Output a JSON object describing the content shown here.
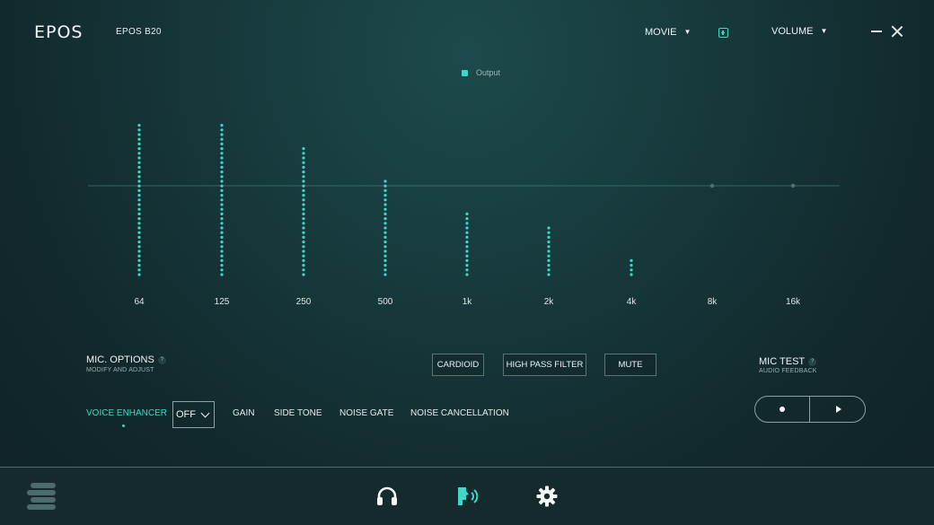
{
  "header": {
    "brand": "EPOS",
    "device_name": "EPOS B20",
    "preset_label": "MOVIE",
    "volume_label": "VOLUME",
    "add_preset_icon": "plus-square-icon",
    "minimize_icon": "minimize-icon",
    "close_icon": "close-icon"
  },
  "chart_data": {
    "type": "bar",
    "legend": [
      "Output"
    ],
    "series": [
      {
        "name": "Output",
        "values": [
          5.5,
          5.5,
          3.5,
          0.5,
          -2.5,
          -3.5,
          -6.5,
          0,
          0
        ]
      }
    ],
    "categories": [
      "64",
      "125",
      "250",
      "500",
      "1k",
      "2k",
      "4k",
      "8k",
      "16k"
    ],
    "ylim": [
      -8,
      5.5
    ],
    "grid": false,
    "colors": {
      "accent": "#3fd8c6",
      "neutral": "#55706f"
    }
  },
  "mic_options": {
    "title": "MIC. OPTIONS",
    "subtitle": "MODIFY AND ADJUST",
    "help": "?",
    "cardioid_label": "CARDIOID",
    "high_pass_label": "HIGH PASS FILTER",
    "mute_label": "MUTE"
  },
  "tabs": {
    "voice_enhancer": "VOICE ENHANCER",
    "gain": "GAIN",
    "side_tone": "SIDE TONE",
    "noise_gate": "NOISE GATE",
    "noise_cancellation": "NOISE CANCELLATION"
  },
  "voice_enhancer_value": "OFF",
  "mic_test": {
    "title": "MIC TEST",
    "subtitle": "AUDIO FEEDBACK",
    "help": "?",
    "record_icon": "record-icon",
    "play_icon": "play-icon"
  },
  "footer": {
    "menu_icon": "menu-icon",
    "headphones_icon": "headphones-icon",
    "microphone_icon": "speaking-icon",
    "settings_icon": "gear-icon"
  }
}
